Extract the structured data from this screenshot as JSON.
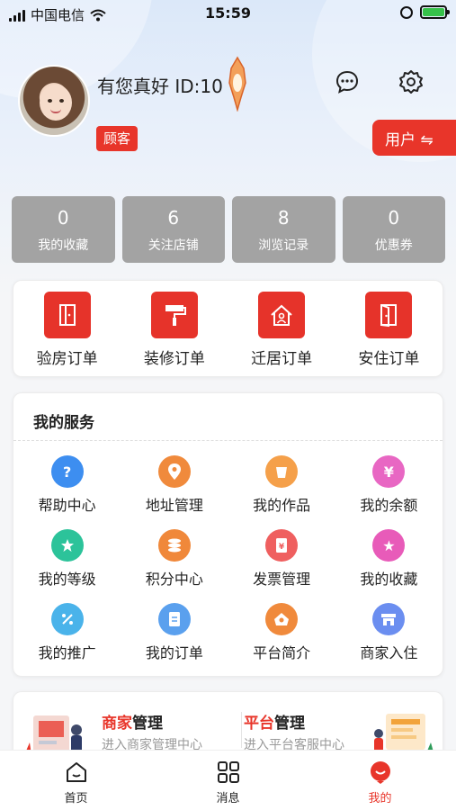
{
  "status_bar": {
    "carrier": "中国电信",
    "time": "15:59"
  },
  "profile": {
    "username": "有您真好 ID:10",
    "role": "顾客",
    "switch_label": "用户 ⇋"
  },
  "stats": [
    {
      "value": "0",
      "label": "我的收藏"
    },
    {
      "value": "6",
      "label": "关注店铺"
    },
    {
      "value": "8",
      "label": "浏览记录"
    },
    {
      "value": "0",
      "label": "优惠券"
    }
  ],
  "orders": [
    {
      "label": "验房订单",
      "icon": "door-icon"
    },
    {
      "label": "装修订单",
      "icon": "paint-roller-icon"
    },
    {
      "label": "迁居订单",
      "icon": "house-icon"
    },
    {
      "label": "安住订单",
      "icon": "open-door-icon"
    }
  ],
  "services": {
    "title": "我的服务",
    "items": [
      {
        "label": "帮助中心",
        "icon": "help-icon",
        "color": "#3d8ef0"
      },
      {
        "label": "地址管理",
        "icon": "location-icon",
        "color": "#f08a3c"
      },
      {
        "label": "我的作品",
        "icon": "cup-icon",
        "color": "#f5a04a"
      },
      {
        "label": "我的余额",
        "icon": "money-bag-icon",
        "color": "#e867c3"
      },
      {
        "label": "我的等级",
        "icon": "vip-icon",
        "color": "#2cc39a"
      },
      {
        "label": "积分中心",
        "icon": "coins-icon",
        "color": "#f0883a"
      },
      {
        "label": "发票管理",
        "icon": "invoice-icon",
        "color": "#ef5f5f"
      },
      {
        "label": "我的收藏",
        "icon": "star-icon",
        "color": "#e85bb9"
      },
      {
        "label": "我的推广",
        "icon": "share-icon",
        "color": "#4ab3ea"
      },
      {
        "label": "我的订单",
        "icon": "order-icon",
        "color": "#5aa0ee"
      },
      {
        "label": "平台简介",
        "icon": "platform-icon",
        "color": "#f08a3c"
      },
      {
        "label": "商家入住",
        "icon": "shop-icon",
        "color": "#6b8ef0"
      }
    ]
  },
  "management": {
    "merchant": {
      "title_hl": "商家",
      "title_rest": "管理",
      "sub": "进入商家管理中心"
    },
    "platform": {
      "title_hl": "平台",
      "title_rest": "管理",
      "sub": "进入平台客服中心"
    }
  },
  "tabbar": [
    {
      "label": "首页",
      "icon": "home-icon"
    },
    {
      "label": "消息",
      "icon": "grid-icon"
    },
    {
      "label": "我的",
      "icon": "mine-icon",
      "active": true
    }
  ],
  "colors": {
    "accent": "#e8352a",
    "stat_bg": "#a3a3a3"
  }
}
